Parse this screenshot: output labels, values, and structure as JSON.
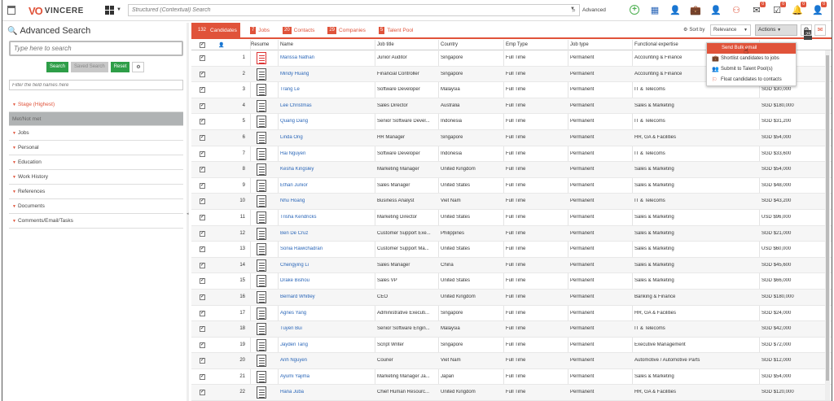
{
  "app": {
    "brand": "VINCERE",
    "logo_mark": "VO"
  },
  "topbar": {
    "search_placeholder": "Structured (Contextual) Search",
    "advanced_label": "Advanced",
    "icons": [
      "add-circle-icon",
      "map-icon",
      "person-icon",
      "briefcase-icon",
      "contact-icon",
      "org-chart-icon",
      "mail-icon",
      "checklist-icon",
      "bell-icon",
      "user-icon"
    ],
    "badges": {
      "mail": "0",
      "checklist": "0",
      "bell": "0",
      "user": "0"
    }
  },
  "left": {
    "title": "Advanced Search",
    "search_placeholder": "Type here to search",
    "buttons": {
      "search": "Search",
      "saved": "Saved Search",
      "reset": "Reset"
    },
    "filter_placeholder": "Filter the field names here",
    "sections": [
      {
        "label": "Stage (Highest)",
        "style": "hl"
      },
      {
        "label": "Met/Not met",
        "style": "grey"
      },
      {
        "label": "Jobs",
        "style": ""
      },
      {
        "label": "Personal",
        "style": ""
      },
      {
        "label": "Education",
        "style": ""
      },
      {
        "label": "Work History",
        "style": ""
      },
      {
        "label": "References",
        "style": ""
      },
      {
        "label": "Documents",
        "style": ""
      },
      {
        "label": "Comments/Email/Tasks",
        "style": ""
      }
    ]
  },
  "tabs": [
    {
      "count": "132",
      "label": "Candidates",
      "active": true
    },
    {
      "count": "7",
      "label": "Jobs",
      "active": false
    },
    {
      "count": "20",
      "label": "Contacts",
      "active": false
    },
    {
      "count": "29",
      "label": "Companies",
      "active": false
    },
    {
      "count": "5",
      "label": "Talent Pool",
      "active": false
    }
  ],
  "toolbar": {
    "sort_label": "Sort by",
    "sort_value": "Relevance",
    "actions_label": "Actions",
    "actions_count": "25"
  },
  "dropdown": [
    "Send Bulk email",
    "Shortlist candidates to jobs",
    "Submit to Talent Pool(s)",
    "Float candidates to contacts"
  ],
  "columns": [
    "Resume",
    "Name",
    "Job title",
    "Country",
    "Emp Type",
    "Job type",
    "Functional expertise"
  ],
  "rows": [
    {
      "n": "1",
      "name": "Marissa Nathan",
      "title": "Junior Auditor",
      "country": "Singapore",
      "emp": "Full Time",
      "job": "Permanent",
      "func": "Accounting & Finance",
      "sal": "",
      "red": true
    },
    {
      "n": "2",
      "name": "Mindy Huang",
      "title": "Financial Controller",
      "country": "Singapore",
      "emp": "Full Time",
      "job": "Permanent",
      "func": "Accounting & Finance",
      "sal": ""
    },
    {
      "n": "3",
      "name": "Trang Le",
      "title": "Software Developer",
      "country": "Malaysia",
      "emp": "Full Time",
      "job": "Permanent",
      "func": "IT & Telecoms",
      "sal": "SGD $30,000"
    },
    {
      "n": "4",
      "name": "Lee Christmas",
      "title": "Sales Director",
      "country": "Australia",
      "emp": "Full Time",
      "job": "Permanent",
      "func": "Sales & Marketing",
      "sal": "SGD $180,000"
    },
    {
      "n": "5",
      "name": "Quang Dang",
      "title": "Senior Software Devel...",
      "country": "Indonesia",
      "emp": "Full Time",
      "job": "Permanent",
      "func": "IT & Telecoms",
      "sal": "SGD $31,200"
    },
    {
      "n": "6",
      "name": "Linda Ong",
      "title": "HR Manager",
      "country": "Singapore",
      "emp": "Full Time",
      "job": "Permanent",
      "func": "HR, GA & Facilities",
      "sal": "SGD $54,000"
    },
    {
      "n": "7",
      "name": "Hai Nguyen",
      "title": "Software Developer",
      "country": "Indonesia",
      "emp": "Full Time",
      "job": "Permanent",
      "func": "IT & Telecoms",
      "sal": "SGD $33,600"
    },
    {
      "n": "8",
      "name": "Kesha Kingsley",
      "title": "Marketing Manager",
      "country": "United Kingdom",
      "emp": "Full Time",
      "job": "Permanent",
      "func": "Sales & Marketing",
      "sal": "SGD $54,000"
    },
    {
      "n": "9",
      "name": "Ethan Junior",
      "title": "Sales Manager",
      "country": "United States",
      "emp": "Full Time",
      "job": "Permanent",
      "func": "Sales & Marketing",
      "sal": "SGD $48,000"
    },
    {
      "n": "10",
      "name": "Nhu Hoang",
      "title": "Business Analyst",
      "country": "Viet Nam",
      "emp": "Full Time",
      "job": "Permanent",
      "func": "IT & Telecoms",
      "sal": "SGD $43,200"
    },
    {
      "n": "11",
      "name": "Trisha Kendricks",
      "title": "Marketing Director",
      "country": "United States",
      "emp": "Full Time",
      "job": "Permanent",
      "func": "Sales & Marketing",
      "sal": "USD $96,000"
    },
    {
      "n": "12",
      "name": "Ben De Cruz",
      "title": "Customer Support Exe...",
      "country": "Philippines",
      "emp": "Full Time",
      "job": "Permanent",
      "func": "Sales & Marketing",
      "sal": "SGD $21,000"
    },
    {
      "n": "13",
      "name": "Sonia Rawichadran",
      "title": "Customer Support Ma...",
      "country": "United States",
      "emp": "Full Time",
      "job": "Permanent",
      "func": "Sales & Marketing",
      "sal": "USD $60,000"
    },
    {
      "n": "14",
      "name": "Chengying Li",
      "title": "Sales Manager",
      "country": "China",
      "emp": "Full Time",
      "job": "Permanent",
      "func": "Sales & Marketing",
      "sal": "SGD $45,600"
    },
    {
      "n": "15",
      "name": "Drake Bishou",
      "title": "Sales VP",
      "country": "United States",
      "emp": "Full Time",
      "job": "Permanent",
      "func": "Sales & Marketing",
      "sal": "SGD $66,000"
    },
    {
      "n": "16",
      "name": "Bernard Whitley",
      "title": "CEO",
      "country": "United Kingdom",
      "emp": "Full Time",
      "job": "Permanent",
      "func": "Banking & Finance",
      "sal": "SGD $180,000"
    },
    {
      "n": "17",
      "name": "Agnes Yang",
      "title": "Administrative Executi...",
      "country": "Singapore",
      "emp": "Full Time",
      "job": "Permanent",
      "func": "HR, GA & Facilities",
      "sal": "SGD $24,000"
    },
    {
      "n": "18",
      "name": "Tuyen Bui",
      "title": "Senior Software Engin...",
      "country": "Malaysia",
      "emp": "Full Time",
      "job": "Permanent",
      "func": "IT & Telecoms",
      "sal": "SGD $42,000"
    },
    {
      "n": "19",
      "name": "Jayden Tang",
      "title": "Script Writer",
      "country": "Singapore",
      "emp": "Full Time",
      "job": "Permanent",
      "func": "Executive Management",
      "sal": "SGD $72,000"
    },
    {
      "n": "20",
      "name": "Anh Nguyen",
      "title": "Courier",
      "country": "Viet Nam",
      "emp": "Full Time",
      "job": "Permanent",
      "func": "Automotive / Automotive Parts",
      "sal": "SGD $12,000"
    },
    {
      "n": "21",
      "name": "Ayumi Yajima",
      "title": "Marketing Manager Ja...",
      "country": "Japan",
      "emp": "Full Time",
      "job": "Permanent",
      "func": "Sales & Marketing",
      "sal": "SGD $54,000"
    },
    {
      "n": "22",
      "name": "Hana Juba",
      "title": "Chief Human Resourc...",
      "country": "United Kingdom",
      "emp": "Full Time",
      "job": "Permanent",
      "func": "HR, GA & Facilities",
      "sal": "SGD $120,000"
    }
  ]
}
